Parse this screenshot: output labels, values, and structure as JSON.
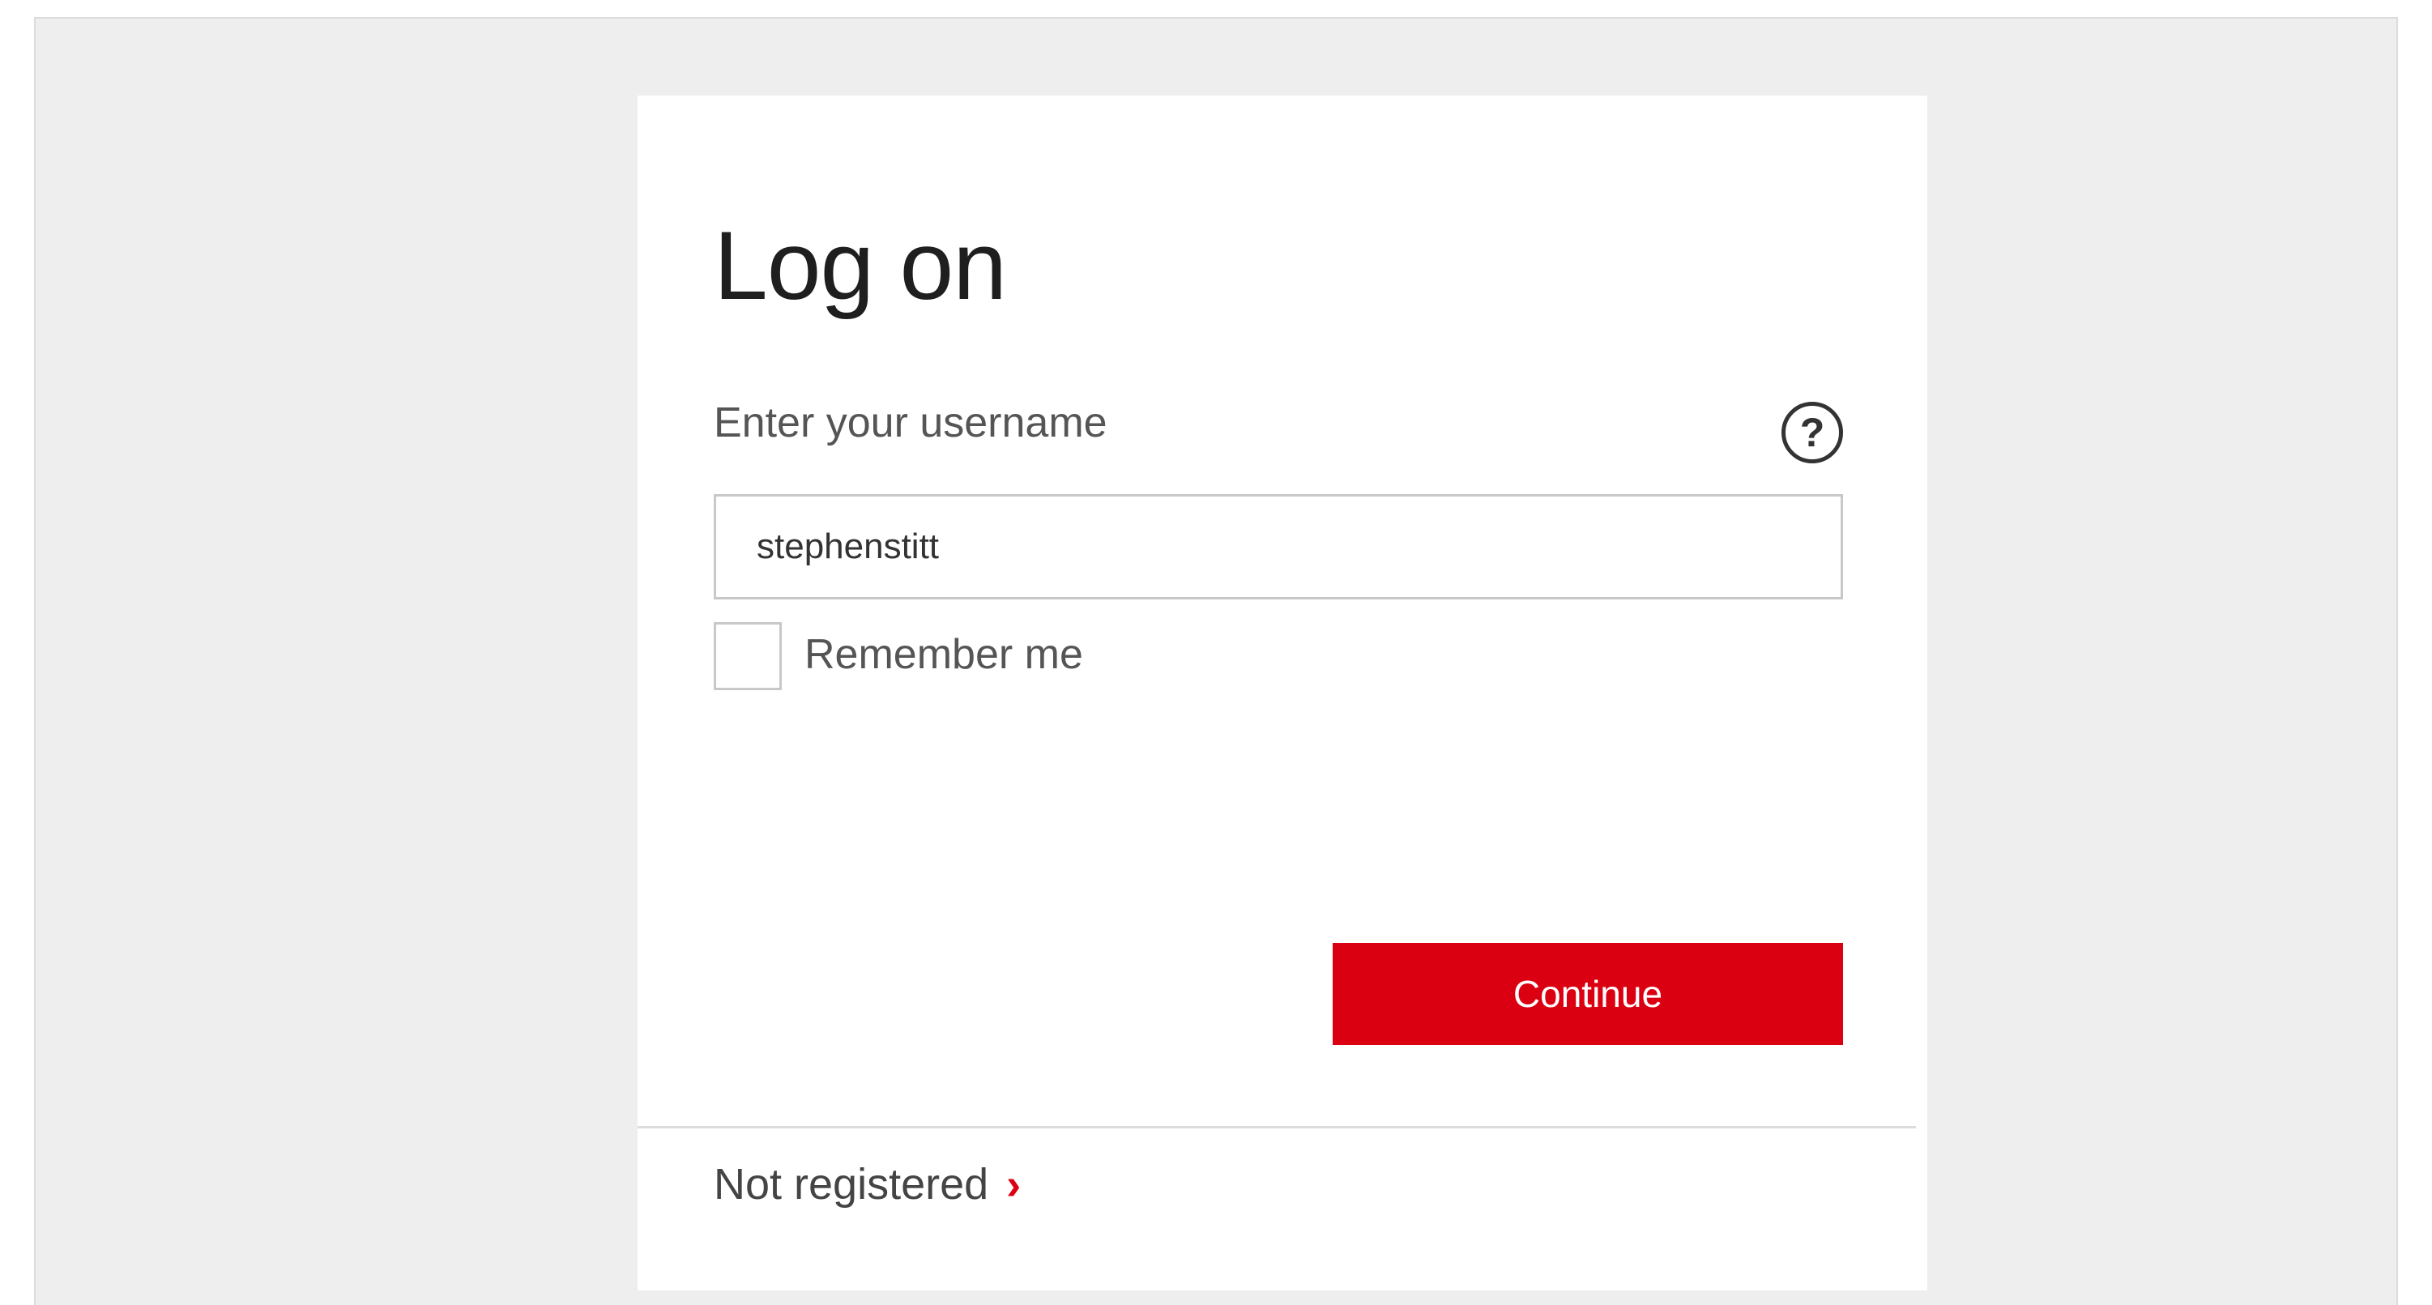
{
  "login": {
    "title": "Log on",
    "username_label": "Enter your username",
    "username_value": "stephenstitt",
    "remember_label": "Remember me",
    "remember_checked": false,
    "continue_label": "Continue",
    "register_label": "Not registered",
    "help_glyph": "?",
    "chevron_glyph": "›"
  },
  "icons": {
    "help": "help-icon",
    "chevron": "chevron-right-icon"
  },
  "colors": {
    "primary": "#db0011",
    "background": "#eeeeee",
    "card": "#ffffff"
  }
}
